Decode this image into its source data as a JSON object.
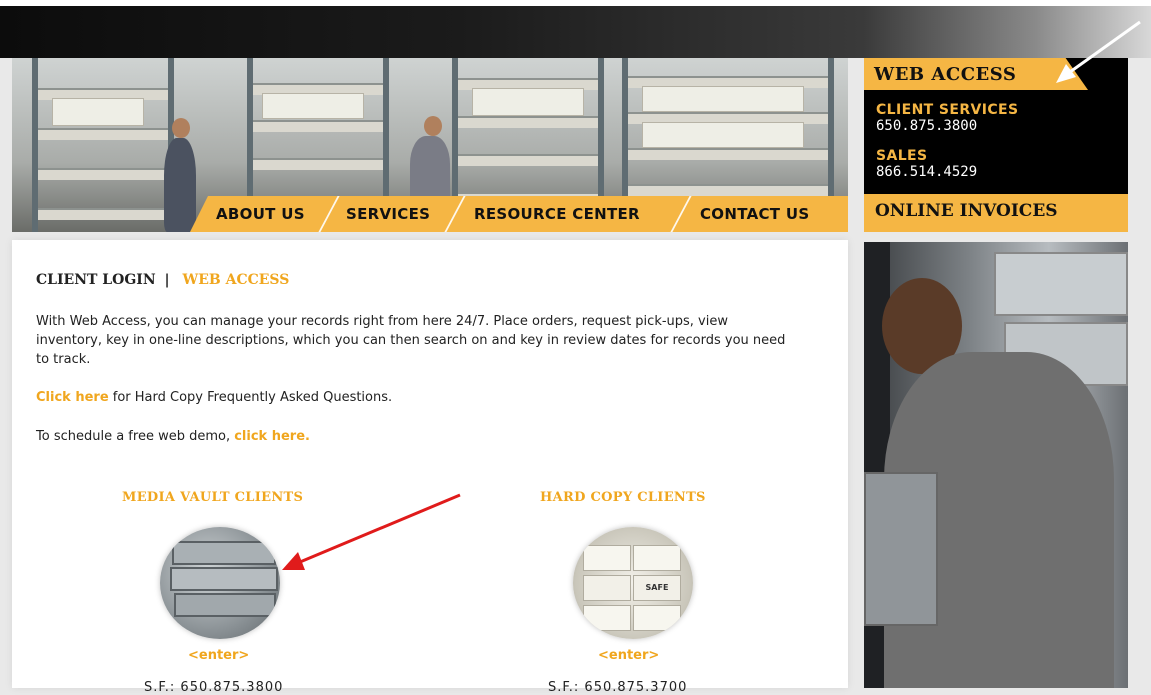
{
  "nav": {
    "about": "ABOUT US",
    "services": "SERVICES",
    "resources": "RESOURCE CENTER",
    "contact": "CONTACT US"
  },
  "sidebar": {
    "web_access": "WEB ACCESS",
    "client_services_label": "CLIENT SERVICES",
    "client_services_phone": "650.875.3800",
    "sales_label": "SALES",
    "sales_phone": "866.514.4529",
    "online_invoices": "ONLINE INVOICES"
  },
  "content": {
    "heading_left": "CLIENT LOGIN",
    "heading_sep": "|",
    "heading_right": "WEB ACCESS",
    "intro": "With Web Access, you can manage your records right from here 24/7. Place orders, request pick-ups, view inventory, key in one-line descriptions, which you can then search on and key in review dates for records you need to track.",
    "faq_link": "Click here",
    "faq_text": " for Hard Copy Frequently Asked Questions.",
    "demo_text": "To schedule a free web demo, ",
    "demo_link": "click here."
  },
  "clients": {
    "media": {
      "title": "MEDIA VAULT CLIENTS",
      "enter": "<enter>",
      "phone": "S.F.: 650.875.3800"
    },
    "hardcopy": {
      "title": "HARD COPY CLIENTS",
      "enter": "<enter>",
      "phone": "S.F.: 650.875.3700",
      "box_label": "SAFE"
    }
  },
  "colors": {
    "accent": "#f5b644",
    "link": "#f0a61e"
  }
}
